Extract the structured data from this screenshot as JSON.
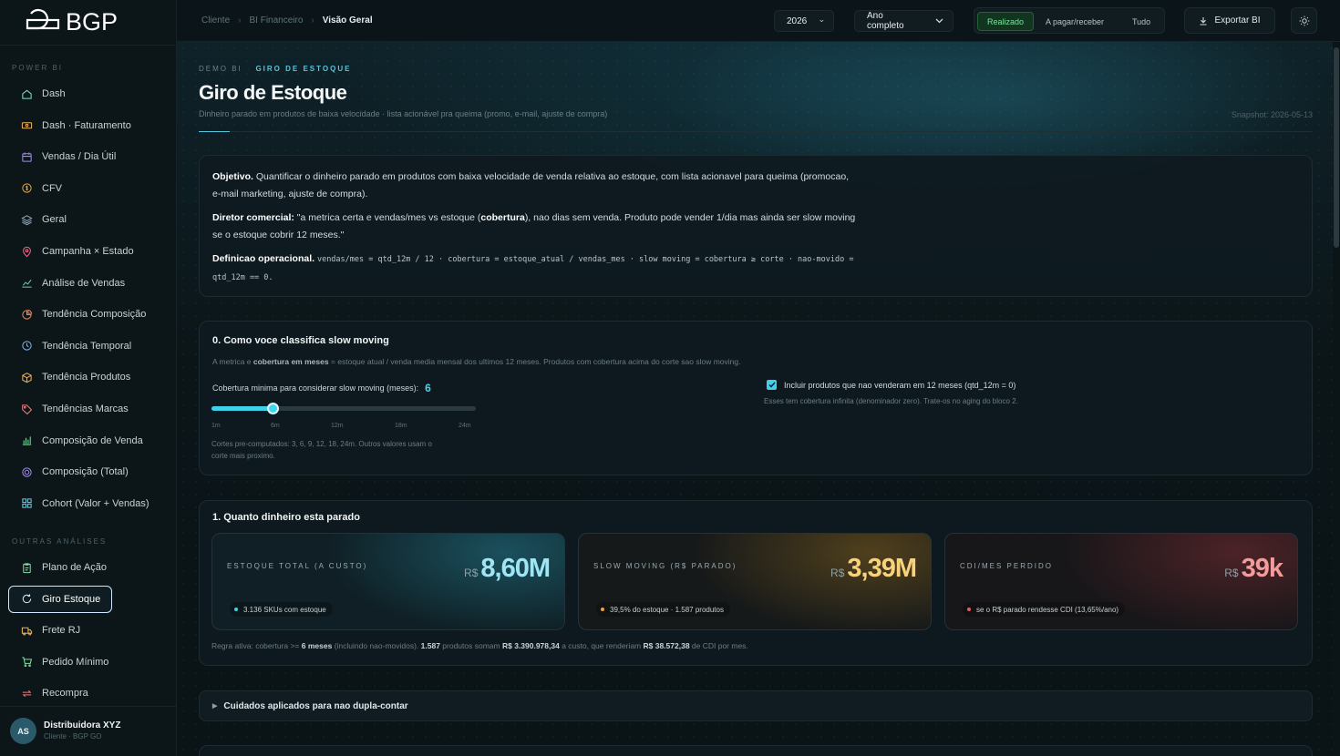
{
  "brand": {
    "logo_text": "BGP"
  },
  "sidebar": {
    "section_powerbi": "POWER BI",
    "section_outras": "OUTRAS ANÁLISES",
    "powerbi_items": [
      {
        "label": "Dash",
        "icon": "home-icon"
      },
      {
        "label": "Dash · Faturamento",
        "icon": "cash-icon"
      },
      {
        "label": "Vendas / Dia Útil",
        "icon": "calendar-icon"
      },
      {
        "label": "CFV",
        "icon": "coin-icon"
      },
      {
        "label": "Geral",
        "icon": "layers-icon"
      },
      {
        "label": "Campanha × Estado",
        "icon": "map-pin-icon"
      },
      {
        "label": "Análise de Vendas",
        "icon": "line-chart-icon"
      },
      {
        "label": "Tendência Composição",
        "icon": "pie-icon"
      },
      {
        "label": "Tendência Temporal",
        "icon": "clock-icon"
      },
      {
        "label": "Tendência Produtos",
        "icon": "box-icon"
      },
      {
        "label": "Tendências Marcas",
        "icon": "tag-icon"
      },
      {
        "label": "Composição de Venda",
        "icon": "bar-chart-icon"
      },
      {
        "label": "Composição (Total)",
        "icon": "target-icon"
      },
      {
        "label": "Cohort (Valor + Vendas)",
        "icon": "grid-icon"
      }
    ],
    "outras_items": [
      {
        "label": "Plano de Ação",
        "icon": "clipboard-icon"
      },
      {
        "label": "Giro Estoque",
        "icon": "refresh-icon",
        "active": true
      },
      {
        "label": "Frete RJ",
        "icon": "truck-icon"
      },
      {
        "label": "Pedido Mínimo",
        "icon": "cart-icon"
      },
      {
        "label": "Recompra",
        "icon": "repeat-icon"
      }
    ],
    "user": {
      "initials": "AS",
      "name": "Distribuidora XYZ",
      "sub": "Cliente · BGP GO"
    }
  },
  "topbar": {
    "breadcrumb": [
      "Cliente",
      "BI Financeiro",
      "Visão Geral"
    ],
    "year": "2026",
    "period": "Ano completo",
    "segments": [
      "Realizado",
      "A pagar/receber",
      "Tudo"
    ],
    "active_segment": "Realizado",
    "export_label": "Exportar BI"
  },
  "header": {
    "eyebrow_a": "DEMO BI",
    "eyebrow_b": "GIRO DE ESTOQUE",
    "title": "Giro de Estoque",
    "subtitle": "Dinheiro parado em produtos de baixa velocidade · lista acionável pra queima (promo, e-mail, ajuste de compra)",
    "snapshot": "Snapshot: 2026-05-13"
  },
  "objective": {
    "obj_label": "Objetivo.",
    "obj_text_1": "Quantificar o dinheiro parado em produtos com baixa velocidade de venda relativa ao estoque, com lista acionavel para queima (promocao,",
    "obj_text_2": "e-mail marketing, ajuste de compra).",
    "dir_label": "Diretor comercial:",
    "dir_text_a": "\"a metrica certa e vendas/mes vs estoque (",
    "dir_bold": "cobertura",
    "dir_text_b": "), nao dias sem venda. Produto pode vender 1/dia mas ainda ser slow moving",
    "dir_text_2": "se o estoque cobrir 12 meses.\"",
    "def_label": "Definicao operacional.",
    "def_code_1": "vendas/mes = qtd_12m / 12 · cobertura = estoque_atual / vendas_mes · slow moving = cobertura ≥ corte · nao-movido =",
    "def_code_2": "qtd_12m == 0."
  },
  "classify": {
    "title": "0. Como voce classifica slow moving",
    "desc_a": "A metrica e ",
    "desc_bold": "cobertura em meses",
    "desc_b": " = estoque atual / venda media mensal dos ultimos 12 meses. Produtos com cobertura acima do corte sao slow moving.",
    "slider_label": "Cobertura minima para considerar slow moving (meses):",
    "slider_value": "6",
    "slider_min": 1,
    "slider_max": 24,
    "slider_current": 6,
    "ticks": [
      "1m",
      "6m",
      "12m",
      "18m",
      "24m"
    ],
    "precomputed_note_1": "Cortes pre-computados: 3, 6, 9, 12, 18, 24m. Outros valores usam o",
    "precomputed_note_2": "corte mais proximo.",
    "checkbox_label": "Incluir produtos que nao venderam em 12 meses (qtd_12m = 0)",
    "checkbox_checked": true,
    "checkbox_note": "Esses tem cobertura infinita (denominador zero). Trate-os no aging do bloco 2."
  },
  "money": {
    "title": "1. Quanto dinheiro esta parado",
    "kpis": [
      {
        "label": "ESTOQUE TOTAL (A CUSTO)",
        "currency": "R$",
        "value": "8,60M",
        "foot": "3.136 SKUs com estoque",
        "color": "#9fe6f5",
        "dot": "#3fd0ea"
      },
      {
        "label": "SLOW MOVING (R$ PARADO)",
        "currency": "R$",
        "value": "3,39M",
        "foot": "39,5% do estoque · 1.587 produtos",
        "color": "#f7d27a",
        "dot": "#f0a431"
      },
      {
        "label": "CDI/MES PERDIDO",
        "currency": "R$",
        "value": "39k",
        "foot": "se o R$ parado rendesse CDI (13,65%/ano)",
        "color": "#f39a9a",
        "dot": "#e85a5a"
      }
    ],
    "rule_a": "Regra ativa: cobertura >= ",
    "rule_b1": "6 meses",
    "rule_c": " (incluindo nao-movidos). ",
    "rule_b2": "1.587",
    "rule_d": " produtos somam ",
    "rule_b3": "R$ 3.390.978,34",
    "rule_e": " a custo, que renderiam ",
    "rule_b4": "R$ 38.572,38",
    "rule_f": " de CDI por mes."
  },
  "collapsible": {
    "label": "Cuidados aplicados para nao dupla-contar"
  },
  "colors": {
    "accent": "#3fd0ea",
    "success": "#7fe3a1"
  }
}
